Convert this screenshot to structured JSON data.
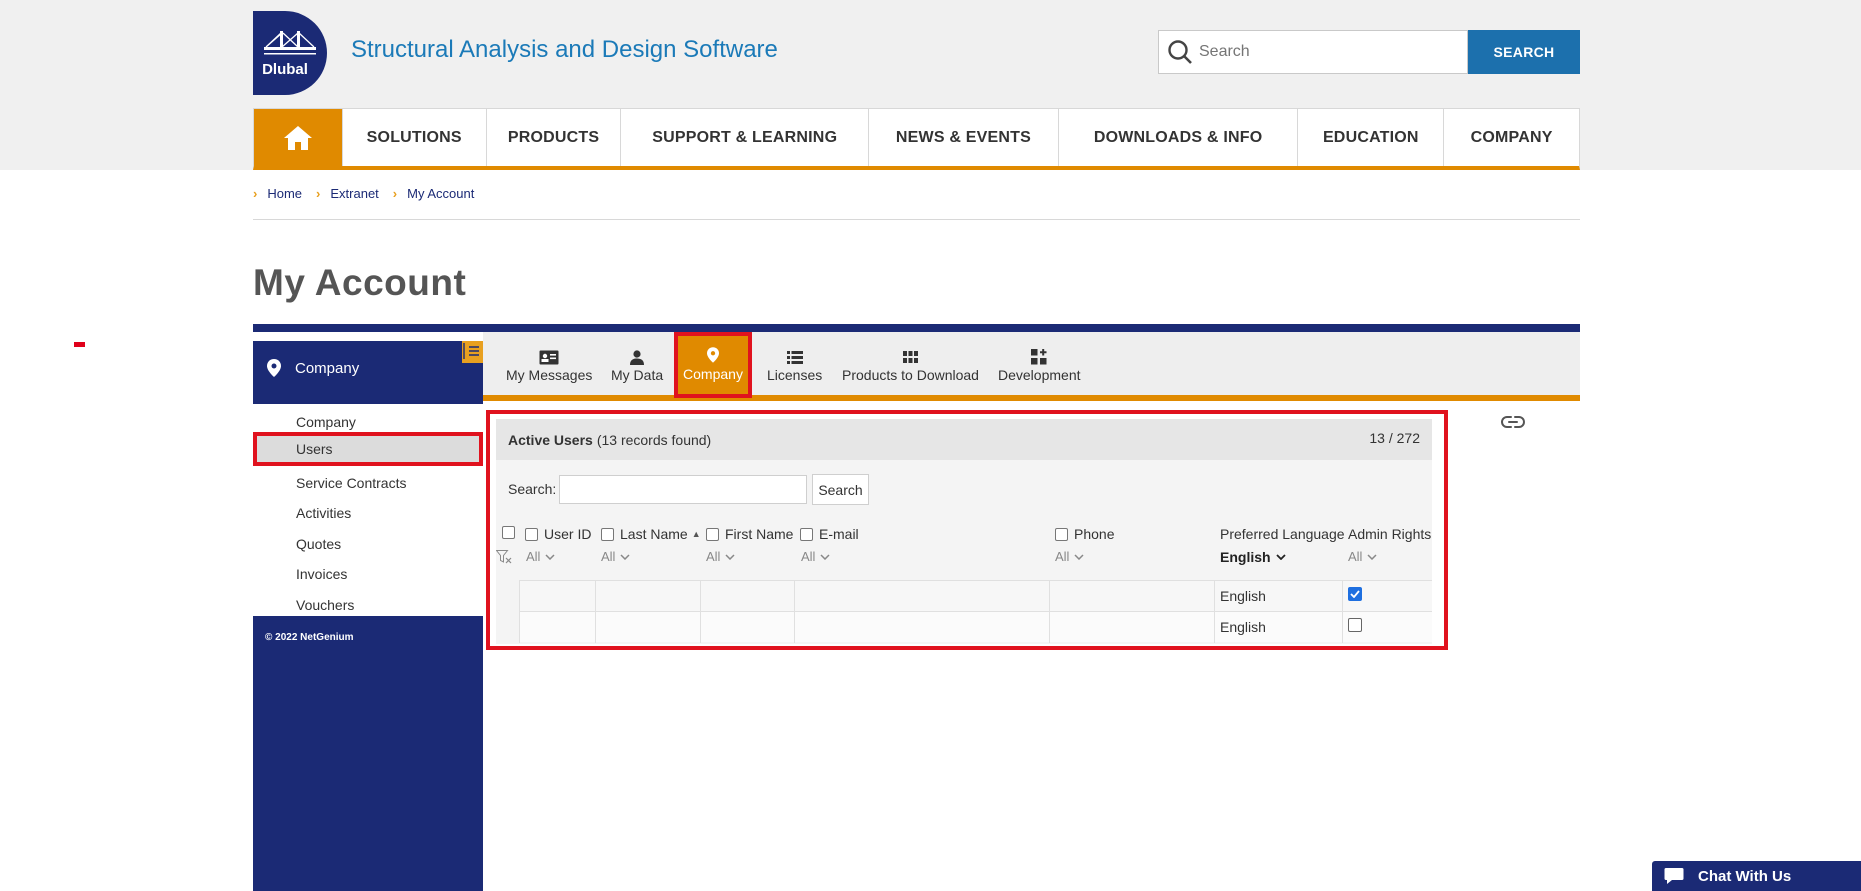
{
  "header": {
    "logo_text": "Dlubal",
    "site_title": "Structural Analysis and Design Software",
    "search_placeholder": "Search",
    "search_button": "SEARCH"
  },
  "nav": {
    "items": [
      "SOLUTIONS",
      "PRODUCTS",
      "SUPPORT & LEARNING",
      "NEWS & EVENTS",
      "DOWNLOADS & INFO",
      "EDUCATION",
      "COMPANY"
    ]
  },
  "breadcrumb": [
    "Home",
    "Extranet",
    "My Account"
  ],
  "page_title": "My Account",
  "account": {
    "section_label": "Company",
    "tabs": [
      "My Messages",
      "My Data",
      "Company",
      "Licenses",
      "Products to Download",
      "Development"
    ],
    "active_tab": "Company",
    "side_menu": [
      "Company",
      "Users",
      "Service Contracts",
      "Activities",
      "Quotes",
      "Invoices",
      "Vouchers"
    ],
    "active_side_item": "Users",
    "copyright": "© 2022 NetGenium"
  },
  "grid": {
    "title": "Active Users",
    "records_text": "(13 records found)",
    "count": "13 / 272",
    "search_label": "Search:",
    "search_button": "Search",
    "columns": [
      "User ID",
      "Last Name",
      "First Name",
      "E-mail",
      "Phone",
      "Preferred Language",
      "Admin Rights"
    ],
    "filters": {
      "user_id": "All",
      "last_name": "All",
      "first_name": "All",
      "email": "All",
      "phone": "All",
      "preferred_language": "English",
      "admin_rights": "All"
    },
    "rows": [
      {
        "language": "English",
        "admin": true
      },
      {
        "language": "English",
        "admin": false
      }
    ]
  },
  "chat": {
    "label": "Chat With Us"
  },
  "colors": {
    "navy": "#1b2a75",
    "orange": "#e08a00",
    "blue_link": "#1b7ab8",
    "highlight_red": "#e0121e"
  }
}
